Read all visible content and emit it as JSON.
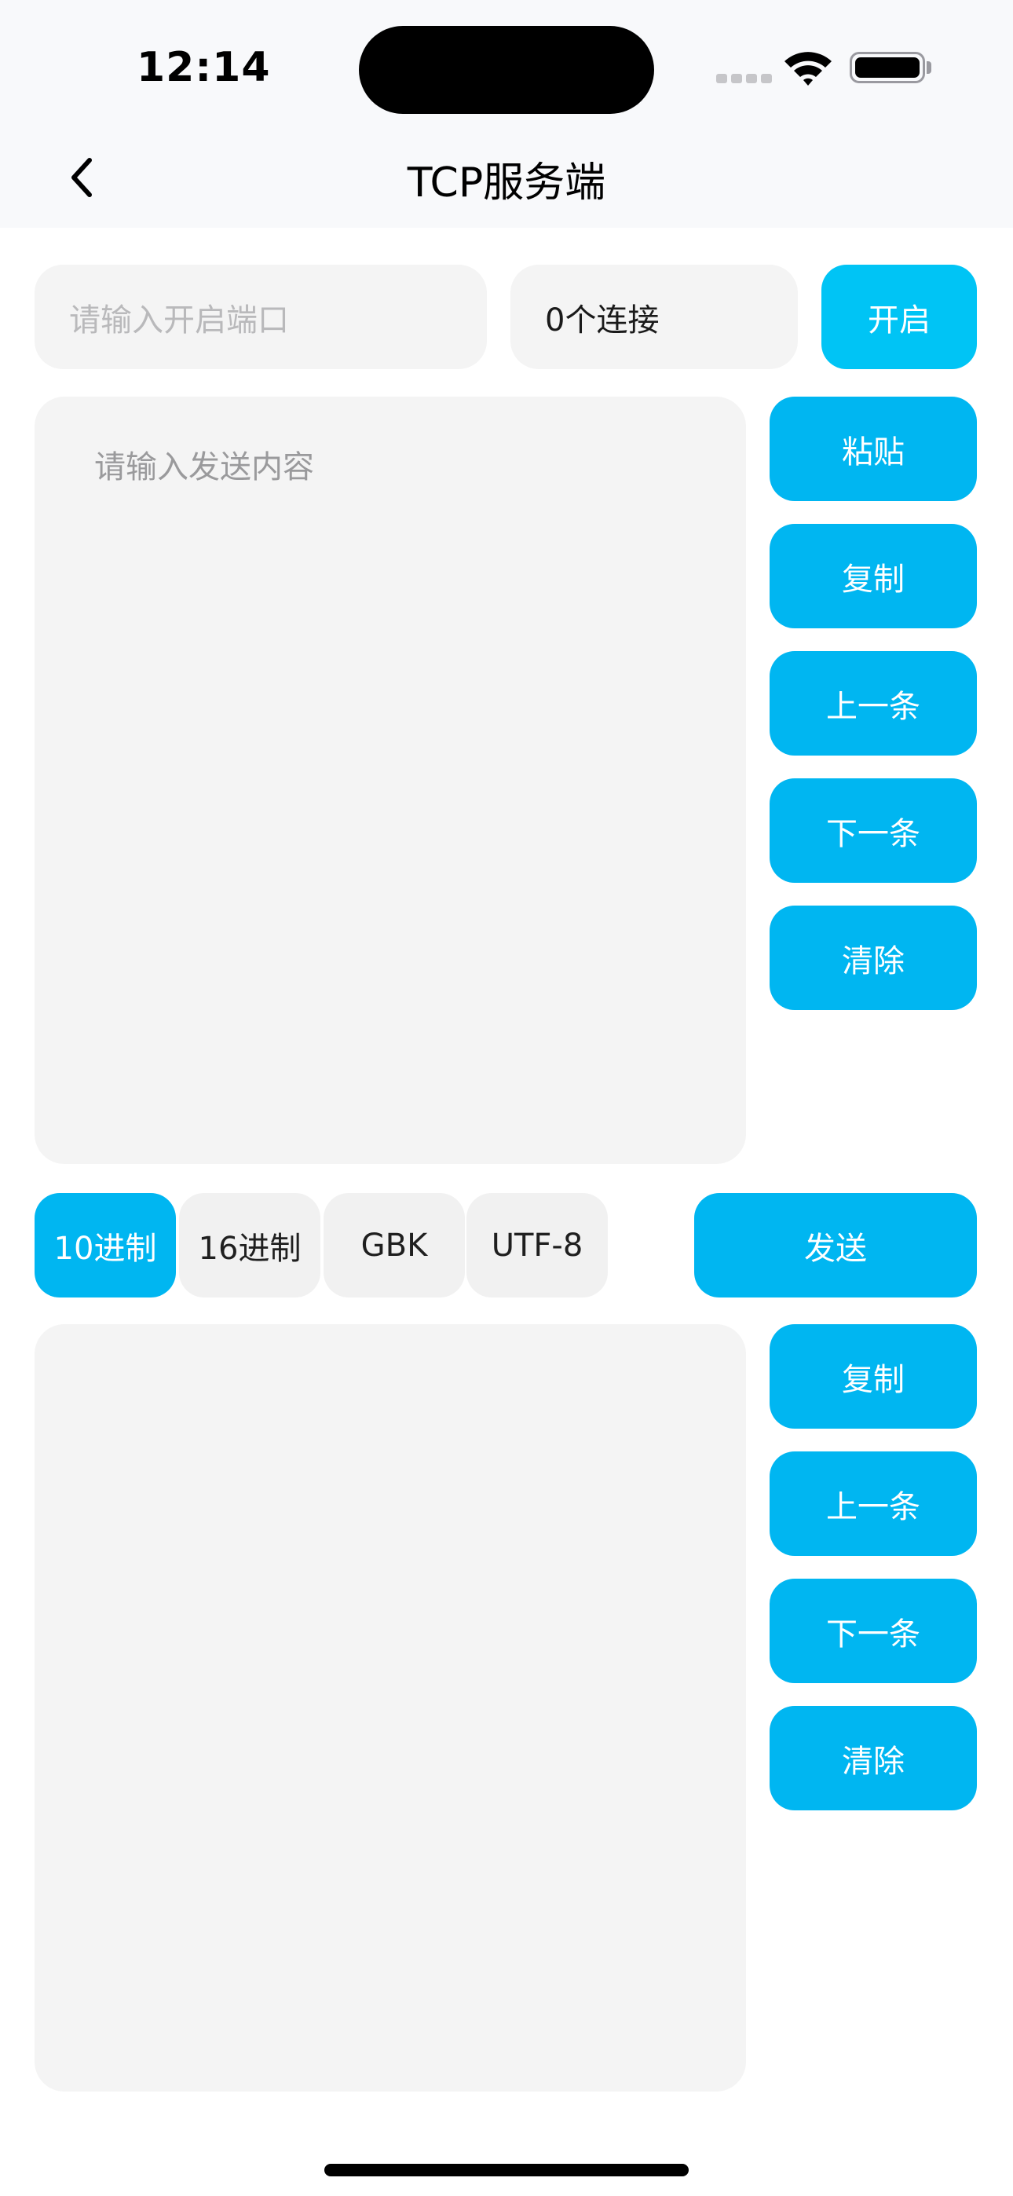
{
  "status_bar": {
    "time": "12:14"
  },
  "nav": {
    "title": "TCP服务端",
    "back_icon": "chevron-left-icon"
  },
  "server": {
    "port_placeholder": "请输入开启端口",
    "connections_text": "0个连接",
    "open_label": "开启"
  },
  "send": {
    "placeholder": "请输入发送内容",
    "actions": [
      "粘贴",
      "复制",
      "上一条",
      "下一条",
      "清除"
    ],
    "send_label": "发送"
  },
  "formats": {
    "options": [
      "10进制",
      "16进制",
      "GBK",
      "UTF-8"
    ],
    "selected": "10进制"
  },
  "receive": {
    "actions": [
      "复制",
      "上一条",
      "下一条",
      "清除"
    ]
  },
  "colors": {
    "accent": "#00b6f1",
    "accent_open": "#00c4f5",
    "field_bg": "#f4f4f4",
    "bar_bg": "#f8f9fb"
  }
}
